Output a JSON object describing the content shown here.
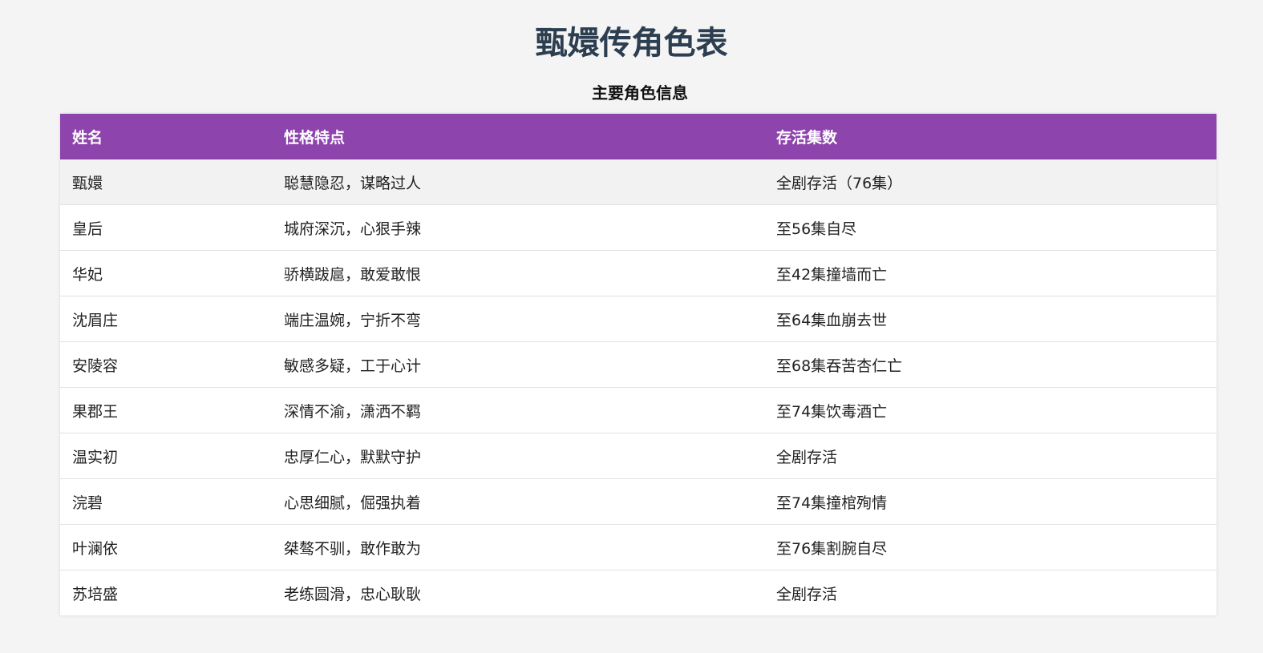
{
  "page": {
    "title": "甄嬛传角色表",
    "caption": "主要角色信息"
  },
  "colors": {
    "header_bg": "#8e44ad",
    "title": "#2c3e50",
    "page_bg": "#f4f4f4"
  },
  "table": {
    "headers": [
      "姓名",
      "性格特点",
      "存活集数"
    ],
    "rows": [
      [
        "甄嬛",
        "聪慧隐忍，谋略过人",
        "全剧存活（76集）"
      ],
      [
        "皇后",
        "城府深沉，心狠手辣",
        "至56集自尽"
      ],
      [
        "华妃",
        "骄横跋扈，敢爱敢恨",
        "至42集撞墙而亡"
      ],
      [
        "沈眉庄",
        "端庄温婉，宁折不弯",
        "至64集血崩去世"
      ],
      [
        "安陵容",
        "敏感多疑，工于心计",
        "至68集吞苦杏仁亡"
      ],
      [
        "果郡王",
        "深情不渝，潇洒不羁",
        "至74集饮毒酒亡"
      ],
      [
        "温实初",
        "忠厚仁心，默默守护",
        "全剧存活"
      ],
      [
        "浣碧",
        "心思细腻，倔强执着",
        "至74集撞棺殉情"
      ],
      [
        "叶澜依",
        "桀骜不驯，敢作敢为",
        "至76集割腕自尽"
      ],
      [
        "苏培盛",
        "老练圆滑，忠心耿耿",
        "全剧存活"
      ]
    ]
  }
}
